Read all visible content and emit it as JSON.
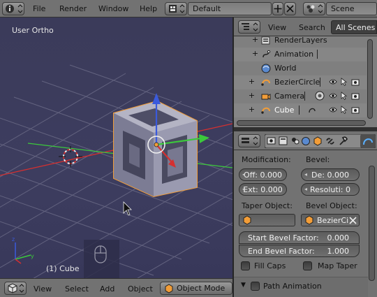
{
  "top_header": {
    "menus": [
      "File",
      "Render",
      "Window",
      "Help"
    ],
    "layout": "Default",
    "scene": "Scene"
  },
  "viewport": {
    "view_name": "User Ortho",
    "object_label": "(1) Cube"
  },
  "bottom_header": {
    "menus": [
      "View",
      "Select",
      "Add",
      "Object"
    ],
    "mode": "Object Mode"
  },
  "outliner": {
    "menus": [
      "View",
      "Search"
    ],
    "filter": "All Scenes",
    "items": [
      {
        "label": "RenderLayers"
      },
      {
        "label": "Animation"
      },
      {
        "label": "World"
      },
      {
        "label": "BezierCircle"
      },
      {
        "label": "Camera"
      },
      {
        "label": "Cube"
      }
    ]
  },
  "properties": {
    "modification_label": "Modification:",
    "bevel_label": "Bevel:",
    "offset": "Off: 0.000",
    "depth": "De: 0.000",
    "extrude": "Ext: 0.000",
    "resolution": "Resoluti: 0",
    "taper_label": "Taper Object:",
    "bevel_object_label": "Bevel Object:",
    "bevel_object_value": "BezierCi",
    "start_bevel_label": "Start Bevel Factor:",
    "start_bevel_value": "0.000",
    "end_bevel_label": "End Bevel Factor:",
    "end_bevel_value": "1.000",
    "fill_caps": "Fill Caps",
    "map_taper": "Map Taper",
    "path_animation": "Path Animation"
  },
  "colors": {
    "header": "#727272",
    "viewport_bg": "#3d3d5f",
    "selection_orange": "#f29d38",
    "axis_x": "#d43030",
    "axis_y": "#3cc83c",
    "axis_z": "#3a5adc"
  }
}
